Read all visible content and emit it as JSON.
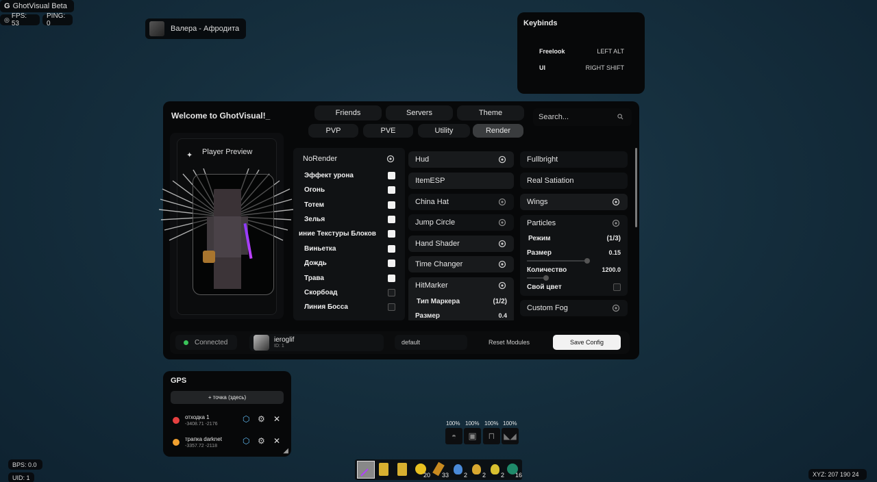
{
  "topleft": {
    "title": "GhotVisual Beta",
    "fps": "FPS: 53",
    "ping": "PING: 0"
  },
  "music": {
    "track": "Валера - Афродита"
  },
  "keybinds": {
    "title": "Keybinds",
    "items": [
      {
        "name": "Freelook",
        "key": "LEFT ALT"
      },
      {
        "name": "UI",
        "key": "RIGHT SHIFT"
      }
    ]
  },
  "main": {
    "welcome": "Welcome to GhotVisual!_",
    "top_tabs": [
      "Friends",
      "Servers",
      "Theme"
    ],
    "cat_tabs": [
      "PVP",
      "PVE",
      "Utility",
      "Render"
    ],
    "active_cat": "Render",
    "search_placeholder": "Search...",
    "preview_label": "Player Preview",
    "col1": {
      "title": "NoRender",
      "items": [
        {
          "label": "Эффект урона",
          "checked": true
        },
        {
          "label": "Огонь",
          "checked": true
        },
        {
          "label": "Тотем",
          "checked": true
        },
        {
          "label": "Зелья",
          "checked": true
        },
        {
          "label": "иние Текстуры Блоков",
          "checked": true
        },
        {
          "label": "Виньетка",
          "checked": true
        },
        {
          "label": "Дождь",
          "checked": true
        },
        {
          "label": "Трава",
          "checked": true
        },
        {
          "label": "Скорбоад",
          "checked": false
        },
        {
          "label": "Линия Босса",
          "checked": false
        }
      ]
    },
    "col2": {
      "modules": [
        "Hud",
        "ItemESP",
        "China Hat",
        "Jump Circle",
        "Hand Shader",
        "Time Changer",
        "HitMarker"
      ],
      "hitmarker": {
        "type_label": "Тип Маркера",
        "type_value": "(1/2)",
        "size_label": "Размер",
        "size_value": "0.4"
      }
    },
    "col3": {
      "modules": [
        "Fullbright",
        "Real Satiation",
        "Wings",
        "Particles"
      ],
      "particles": {
        "mode_label": "Режим",
        "mode_value": "(1/3)",
        "size_label": "Размер",
        "size_value": "0.15",
        "count_label": "Количество",
        "count_value": "1200.0",
        "color_label": "Свой цвет"
      },
      "custom_fog": "Custom Fog"
    },
    "footer": {
      "connected": "Connected",
      "username": "ieroglif",
      "user_id": "ID: 1",
      "config": "default",
      "reset": "Reset Modules",
      "save": "Save Config"
    }
  },
  "gps": {
    "title": "GPS",
    "add": "+ точка (здесь)",
    "points": [
      {
        "name": "отходка 1",
        "coords": "-3408.71 -2176",
        "color": "#e64040"
      },
      {
        "name": "трапка darknet",
        "coords": "-3357.72 -2118",
        "color": "#f0a030"
      }
    ]
  },
  "armor": {
    "values": [
      "100%",
      "100%",
      "100%",
      "100%"
    ]
  },
  "hotbar": {
    "counts": [
      "",
      "",
      "",
      "20",
      "33",
      "2",
      "2",
      "2",
      "16"
    ]
  },
  "bottom": {
    "bps": "BPS: 0.0",
    "uid": "UID: 1",
    "xyz": "XYZ: 207 190 24"
  }
}
